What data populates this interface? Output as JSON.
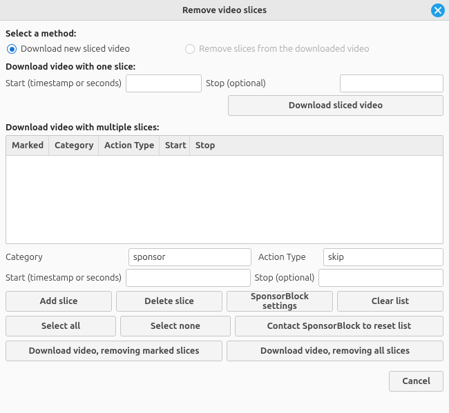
{
  "window": {
    "title": "Remove video slices"
  },
  "method": {
    "heading": "Select a method:",
    "opt1": "Download new sliced video",
    "opt2": "Remove slices from the downloaded video"
  },
  "single": {
    "heading": "Download video with one slice:",
    "start_label": "Start (timestamp or seconds)",
    "stop_label": "Stop (optional)",
    "start_value": "",
    "stop_value": "",
    "download_btn": "Download sliced video"
  },
  "multi": {
    "heading": "Download video with multiple slices:",
    "columns": {
      "marked": "Marked",
      "category": "Category",
      "action_type": "Action Type",
      "start": "Start",
      "stop": "Stop"
    },
    "rows": [],
    "category_label": "Category",
    "category_value": "sponsor",
    "action_type_label": "Action Type",
    "action_type_value": "skip",
    "start_label": "Start (timestamp or seconds)",
    "stop_label": "Stop (optional)",
    "start_value": "",
    "stop_value": ""
  },
  "buttons": {
    "add_slice": "Add slice",
    "delete_slice": "Delete slice",
    "sponsorblock_settings": "SponsorBlock settings",
    "clear_list": "Clear list",
    "select_all": "Select all",
    "select_none": "Select none",
    "contact_reset": "Contact SponsorBlock to reset list",
    "dl_remove_marked": "Download video, removing marked slices",
    "dl_remove_all": "Download video, removing all slices",
    "cancel": "Cancel"
  }
}
